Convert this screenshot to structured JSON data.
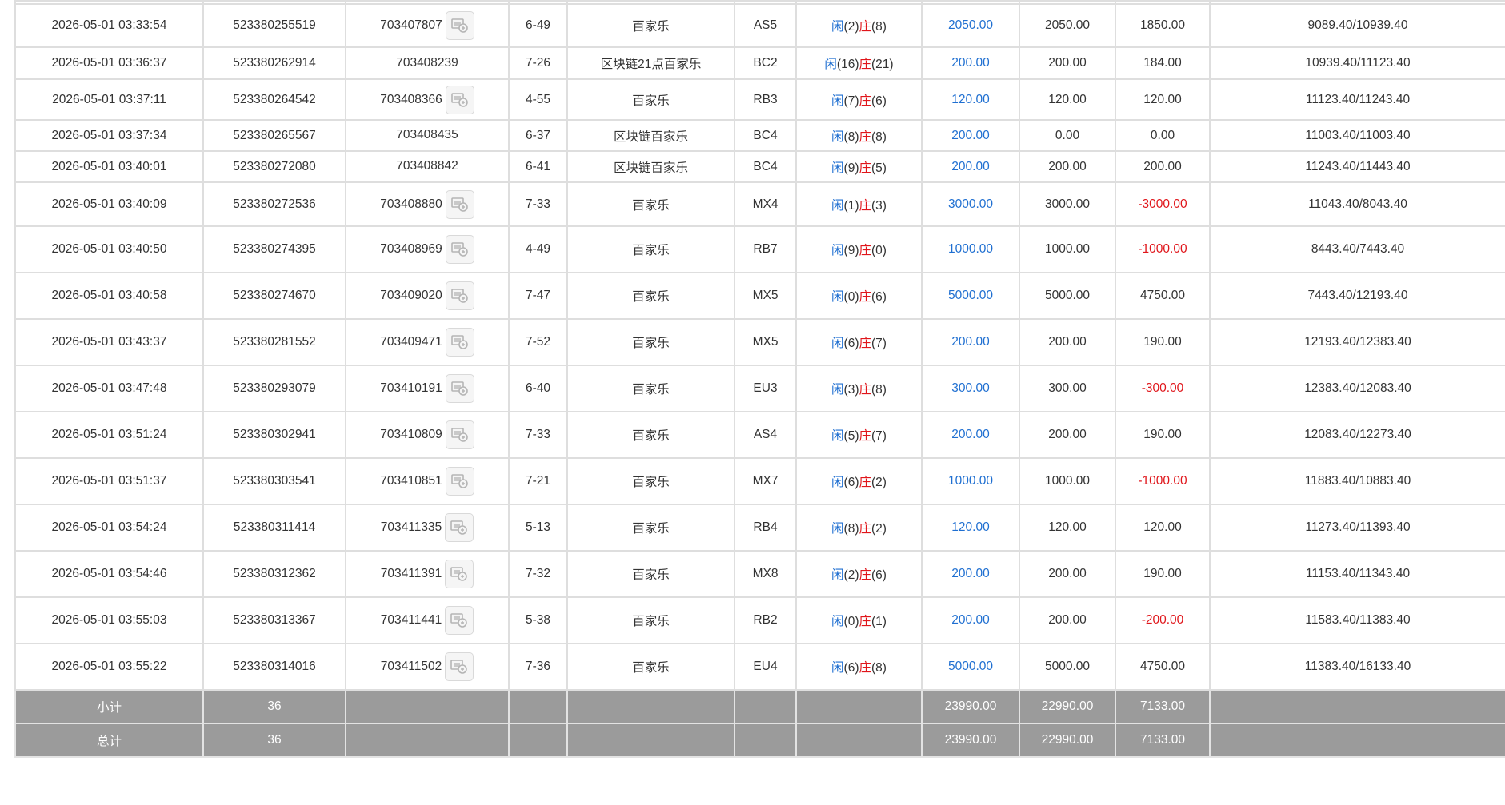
{
  "colors": {
    "player_blue": "#1f6fd1",
    "banker_red": "#e0161b",
    "summary_bg": "#9b9b9b",
    "grid_line": "#dedede"
  },
  "rows": [
    {
      "time": "2026-05-01 03:33:54",
      "order_no": "523380255519",
      "ticket_no": "703407807",
      "has_thumb": true,
      "shoe": "6-49",
      "game": "百家乐",
      "table": "AS5",
      "player_label": "闲",
      "player_val": "(2)",
      "banker_label": "庄",
      "banker_val": "(8)",
      "bet": "2050.00",
      "valid_bet": "2050.00",
      "win_loss": "1850.00",
      "win_loss_negative": false,
      "balance": "9089.40/10939.40"
    },
    {
      "time": "2026-05-01 03:36:37",
      "order_no": "523380262914",
      "ticket_no": "703408239",
      "has_thumb": false,
      "shoe": "7-26",
      "game": "区块链21点百家乐",
      "table": "BC2",
      "player_label": "闲",
      "player_val": "(16)",
      "banker_label": "庄",
      "banker_val": "(21)",
      "bet": "200.00",
      "valid_bet": "200.00",
      "win_loss": "184.00",
      "win_loss_negative": false,
      "balance": "10939.40/11123.40"
    },
    {
      "time": "2026-05-01 03:37:11",
      "order_no": "523380264542",
      "ticket_no": "703408366",
      "has_thumb": true,
      "shoe": "4-55",
      "game": "百家乐",
      "table": "RB3",
      "player_label": "闲",
      "player_val": "(7)",
      "banker_label": "庄",
      "banker_val": "(6)",
      "bet": "120.00",
      "valid_bet": "120.00",
      "win_loss": "120.00",
      "win_loss_negative": false,
      "balance": "11123.40/11243.40"
    },
    {
      "time": "2026-05-01 03:37:34",
      "order_no": "523380265567",
      "ticket_no": "703408435",
      "has_thumb": false,
      "shoe": "6-37",
      "game": "区块链百家乐",
      "table": "BC4",
      "player_label": "闲",
      "player_val": "(8)",
      "banker_label": "庄",
      "banker_val": "(8)",
      "bet": "200.00",
      "valid_bet": "0.00",
      "win_loss": "0.00",
      "win_loss_negative": false,
      "balance": "11003.40/11003.40"
    },
    {
      "time": "2026-05-01 03:40:01",
      "order_no": "523380272080",
      "ticket_no": "703408842",
      "has_thumb": false,
      "shoe": "6-41",
      "game": "区块链百家乐",
      "table": "BC4",
      "player_label": "闲",
      "player_val": "(9)",
      "banker_label": "庄",
      "banker_val": "(5)",
      "bet": "200.00",
      "valid_bet": "200.00",
      "win_loss": "200.00",
      "win_loss_negative": false,
      "balance": "11243.40/11443.40"
    },
    {
      "time": "2026-05-01 03:40:09",
      "order_no": "523380272536",
      "ticket_no": "703408880",
      "has_thumb": true,
      "shoe": "7-33",
      "game": "百家乐",
      "table": "MX4",
      "player_label": "闲",
      "player_val": "(1)",
      "banker_label": "庄",
      "banker_val": "(3)",
      "bet": "3000.00",
      "valid_bet": "3000.00",
      "win_loss": "-3000.00",
      "win_loss_negative": true,
      "balance": "11043.40/8043.40"
    },
    {
      "time": "2026-05-01 03:40:50",
      "order_no": "523380274395",
      "ticket_no": "703408969",
      "has_thumb": true,
      "shoe": "4-49",
      "game": "百家乐",
      "table": "RB7",
      "player_label": "闲",
      "player_val": "(9)",
      "banker_label": "庄",
      "banker_val": "(0)",
      "bet": "1000.00",
      "valid_bet": "1000.00",
      "win_loss": "-1000.00",
      "win_loss_negative": true,
      "balance": "8443.40/7443.40"
    },
    {
      "time": "2026-05-01 03:40:58",
      "order_no": "523380274670",
      "ticket_no": "703409020",
      "has_thumb": true,
      "shoe": "7-47",
      "game": "百家乐",
      "table": "MX5",
      "player_label": "闲",
      "player_val": "(0)",
      "banker_label": "庄",
      "banker_val": "(6)",
      "bet": "5000.00",
      "valid_bet": "5000.00",
      "win_loss": "4750.00",
      "win_loss_negative": false,
      "balance": "7443.40/12193.40"
    },
    {
      "time": "2026-05-01 03:43:37",
      "order_no": "523380281552",
      "ticket_no": "703409471",
      "has_thumb": true,
      "shoe": "7-52",
      "game": "百家乐",
      "table": "MX5",
      "player_label": "闲",
      "player_val": "(6)",
      "banker_label": "庄",
      "banker_val": "(7)",
      "bet": "200.00",
      "valid_bet": "200.00",
      "win_loss": "190.00",
      "win_loss_negative": false,
      "balance": "12193.40/12383.40"
    },
    {
      "time": "2026-05-01 03:47:48",
      "order_no": "523380293079",
      "ticket_no": "703410191",
      "has_thumb": true,
      "shoe": "6-40",
      "game": "百家乐",
      "table": "EU3",
      "player_label": "闲",
      "player_val": "(3)",
      "banker_label": "庄",
      "banker_val": "(8)",
      "bet": "300.00",
      "valid_bet": "300.00",
      "win_loss": "-300.00",
      "win_loss_negative": true,
      "balance": "12383.40/12083.40"
    },
    {
      "time": "2026-05-01 03:51:24",
      "order_no": "523380302941",
      "ticket_no": "703410809",
      "has_thumb": true,
      "shoe": "7-33",
      "game": "百家乐",
      "table": "AS4",
      "player_label": "闲",
      "player_val": "(5)",
      "banker_label": "庄",
      "banker_val": "(7)",
      "bet": "200.00",
      "valid_bet": "200.00",
      "win_loss": "190.00",
      "win_loss_negative": false,
      "balance": "12083.40/12273.40"
    },
    {
      "time": "2026-05-01 03:51:37",
      "order_no": "523380303541",
      "ticket_no": "703410851",
      "has_thumb": true,
      "shoe": "7-21",
      "game": "百家乐",
      "table": "MX7",
      "player_label": "闲",
      "player_val": "(6)",
      "banker_label": "庄",
      "banker_val": "(2)",
      "bet": "1000.00",
      "valid_bet": "1000.00",
      "win_loss": "-1000.00",
      "win_loss_negative": true,
      "balance": "11883.40/10883.40"
    },
    {
      "time": "2026-05-01 03:54:24",
      "order_no": "523380311414",
      "ticket_no": "703411335",
      "has_thumb": true,
      "shoe": "5-13",
      "game": "百家乐",
      "table": "RB4",
      "player_label": "闲",
      "player_val": "(8)",
      "banker_label": "庄",
      "banker_val": "(2)",
      "bet": "120.00",
      "valid_bet": "120.00",
      "win_loss": "120.00",
      "win_loss_negative": false,
      "balance": "11273.40/11393.40"
    },
    {
      "time": "2026-05-01 03:54:46",
      "order_no": "523380312362",
      "ticket_no": "703411391",
      "has_thumb": true,
      "shoe": "7-32",
      "game": "百家乐",
      "table": "MX8",
      "player_label": "闲",
      "player_val": "(2)",
      "banker_label": "庄",
      "banker_val": "(6)",
      "bet": "200.00",
      "valid_bet": "200.00",
      "win_loss": "190.00",
      "win_loss_negative": false,
      "balance": "11153.40/11343.40"
    },
    {
      "time": "2026-05-01 03:55:03",
      "order_no": "523380313367",
      "ticket_no": "703411441",
      "has_thumb": true,
      "shoe": "5-38",
      "game": "百家乐",
      "table": "RB2",
      "player_label": "闲",
      "player_val": "(0)",
      "banker_label": "庄",
      "banker_val": "(1)",
      "bet": "200.00",
      "valid_bet": "200.00",
      "win_loss": "-200.00",
      "win_loss_negative": true,
      "balance": "11583.40/11383.40"
    },
    {
      "time": "2026-05-01 03:55:22",
      "order_no": "523380314016",
      "ticket_no": "703411502",
      "has_thumb": true,
      "shoe": "7-36",
      "game": "百家乐",
      "table": "EU4",
      "player_label": "闲",
      "player_val": "(6)",
      "banker_label": "庄",
      "banker_val": "(8)",
      "bet": "5000.00",
      "valid_bet": "5000.00",
      "win_loss": "4750.00",
      "win_loss_negative": false,
      "balance": "11383.40/16133.40"
    }
  ],
  "subtotal": {
    "label": "小计",
    "count": "36",
    "bet": "23990.00",
    "valid_bet": "22990.00",
    "win_loss": "7133.00"
  },
  "total": {
    "label": "总计",
    "count": "36",
    "bet": "23990.00",
    "valid_bet": "22990.00",
    "win_loss": "7133.00"
  }
}
